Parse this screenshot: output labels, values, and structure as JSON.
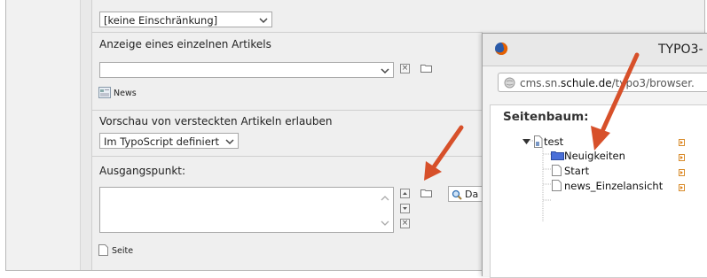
{
  "form": {
    "restriction_select": "[keine Einschränkung]",
    "single_article_label": "Anzeige eines einzelnen Artikels",
    "single_article_select": "",
    "news_label": "News",
    "preview_hidden_label": "Vorschau von versteckten Artikeln erlauben",
    "preview_hidden_select": "Im TypoScript definiert",
    "start_point_label": "Ausgangspunkt:",
    "page_label": "Seite",
    "search_button_text": "Da"
  },
  "popup": {
    "title": "TYPO3-",
    "url_prefix": "cms.sn.",
    "url_domain": "schule.de",
    "url_suffix": "/typo3/browser.",
    "tree_heading": "Seitenbaum:",
    "tree": [
      {
        "label": "test"
      },
      {
        "label": "Neuigkeiten"
      },
      {
        "label": "Start"
      },
      {
        "label": "news_Einzelansicht"
      }
    ]
  },
  "colors": {
    "annotation_arrow": "#d7502a",
    "folder_blue": "#4a6fd8",
    "firefox_orange": "#e66000"
  }
}
